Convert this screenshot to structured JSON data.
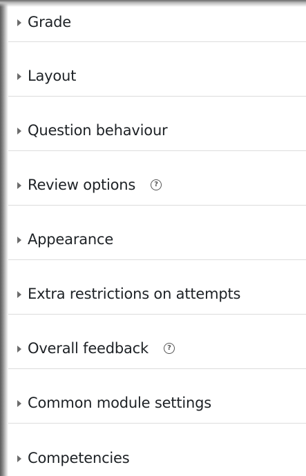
{
  "sections": [
    {
      "label": "Grade",
      "help": false
    },
    {
      "label": "Layout",
      "help": false
    },
    {
      "label": "Question behaviour",
      "help": false
    },
    {
      "label": "Review options",
      "help": true
    },
    {
      "label": "Appearance",
      "help": false
    },
    {
      "label": "Extra restrictions on attempts",
      "help": false
    },
    {
      "label": "Overall feedback",
      "help": true
    },
    {
      "label": "Common module settings",
      "help": false
    },
    {
      "label": "Competencies",
      "help": false
    }
  ],
  "help_glyph": "?",
  "icons": {
    "caret": "chevron-right-icon",
    "help": "help-icon"
  }
}
